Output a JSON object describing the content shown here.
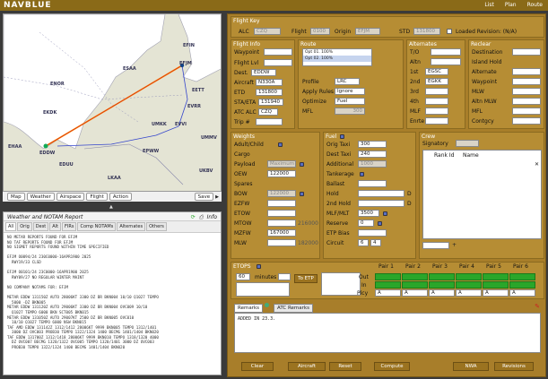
{
  "app": {
    "logo": "NAVBLUE",
    "links": [
      "List",
      "Plan",
      "Route"
    ]
  },
  "map": {
    "labels": [
      "EFIN",
      "ESAA",
      "ENOR",
      "EFJM",
      "EETT",
      "EKDK",
      "EVRR",
      "UMKK",
      "EVVI",
      "UMMV",
      "EHAA",
      "EDDW",
      "EDUU",
      "EPWW",
      "LKAA",
      "UKBV"
    ],
    "toolbar": [
      "Map",
      "Weather",
      "Airspace",
      "Flight",
      "Action",
      "Save"
    ]
  },
  "weather": {
    "title": "Weather and NOTAM Report",
    "info": "Info",
    "tabs": [
      "All",
      "Orig",
      "Dest",
      "Alt",
      "FIRs",
      "Comp NOTAMs",
      "Alternates",
      "Others"
    ],
    "lines": [
      "NO METAR REPORTS FOUND FOR EFJM",
      "NO TAF REPORTS FOUND FOR EFJM",
      "NO SIGMET REPORTS FOUND WITHIN TIME SPECIFIED",
      "",
      "EFJM O0094/24 230C0000-16APR1900 2025",
      "  RWY19/33 CLSD",
      "",
      "EFJM O0101/24 23C0000-16APR1900 2025",
      "  RWY09/27 NO REGULAR WINTER MAINT",
      "",
      "NO COMPANY NOTAMS FOR: EFJM",
      "",
      "METAR EDDW 131150Z AUTO 28006KT 3300 DZ BR BKN004 10/10 Q1027 TEMPO",
      "  5000 -DZ BKN005",
      "METAR EDDW 131120Z AUTO 29006KT 3300 DZ BR BKN004 OVC009 10/10",
      "  Q1027 TEMPO 6000 BKN SCT005 BKN015",
      "METAR EDDW 131050Z AUTO 29007KT 2500 DZ BR BKN005 OVC010",
      "  10/10 Q1027 TEMPO 6000 NSW BKN015",
      "TAF AMD EDDW 131142Z 1312/1412 28006KT 9999 BKN005 TEMPO 1312/1401",
      "  3000 DZ OVC003 PROB30 TEMPO 1322/1324 1400 BECMG 1401/1404 BKN020",
      "TAF EDDW 131700Z 1312/1418 28006KT 9999 BKN010 TEMPO 1318/1320 4000",
      "  DZ OVC007 BECMG 1320/1322 OVC005 TEMPO 1320/1401 3000 DZ OVC003",
      "  PROB30 TEMPO 1322/1324 1400 BECMG 1401/1404 BKN020"
    ]
  },
  "flight": {
    "section_key": "Flight Key",
    "alc_label": "ALC",
    "alc": "CZQ",
    "flight_label": "Flight",
    "flight": "0100",
    "origin_label": "Origin",
    "origin": "EFJM",
    "std_label": "STD",
    "std": "131800",
    "loaded_revision": "Loaded Revision: (N/A)",
    "info_title": "Flight Info",
    "waypoint_label": "Waypoint",
    "flightlvl_label": "Flight Lvl",
    "dest_label": "Dest.",
    "dest": "EDDW",
    "aircraft_label": "Aircraft",
    "aircraft": "N330A",
    "etd_label": "ETD",
    "etd": "131800",
    "staeta_label": "STA/ETA",
    "staeta": "131940",
    "atcalc_label": "ATC ALC",
    "atcalc": "CZQ",
    "trip_label": "Trip #",
    "route_title": "Route",
    "route_items": [
      "Opt 01. 100%",
      "Opt 02. 100%"
    ],
    "profile_label": "Profile",
    "profile": "LRC",
    "apply_label": "Apply Rules",
    "apply": "Ignore",
    "optimize_label": "Optimize",
    "optimize": "Fuel",
    "mfl_label": "MFL",
    "mfl": "300",
    "alt_title": "Alternates",
    "to_label": "T/O",
    "altn_label": "Altn",
    "alt1_label": "1st",
    "alt1": "EGSC",
    "alt2_label": "2nd",
    "alt2": "EGKK",
    "alt3_label": "3rd",
    "alt4_label": "4th",
    "mlf_label": "MLF",
    "enrte_label": "Enrte",
    "reclear_title": "Reclear",
    "destination_label": "Destination",
    "islandhold_label": "Island Hold",
    "alternate_label": "Alternate",
    "waypoint2_label": "Waypoint",
    "mlw_label": "MLW",
    "altnmlw_label": "Altn MLW",
    "mfl2_label": "MFL",
    "contgcy_label": "Contgcy",
    "weights_title": "Weights",
    "adult_label": "Adult/Child",
    "cargo_label": "Cargo",
    "payload_label": "Payload",
    "payload_hint": "Maximum",
    "oew_label": "OEW",
    "oew": "122000",
    "spares_label": "Spares",
    "bow_label": "BOW",
    "bow": "122000",
    "ezfw_label": "EZFW",
    "etow_label": "ETOW",
    "mtow_label": "MTOW",
    "mtow": "216000",
    "mzfw_label": "MZFW",
    "mzfw": "167000",
    "mlw2_label": "MLW",
    "mlw2": "182000",
    "fuel_title": "Fuel",
    "origtaxi_label": "Orig Taxi",
    "origtaxi": "300",
    "desttaxi_label": "Dest Taxi",
    "desttaxi": "240",
    "additional_label": "Additional",
    "additional": "1000",
    "tankerage_label": "Tankerage",
    "ballast_label": "Ballast",
    "hold_label": "Hold",
    "hold2_label": "2nd Hold",
    "mlfmlt_label": "MLF/MLT",
    "mlfmlt": "3500",
    "reserve_label": "Reserve",
    "reserve": "0",
    "etpbias_label": "ETP Bias",
    "circuit_label": "Circuit",
    "circuit1": "6",
    "circuit2": "4",
    "d_label": "D",
    "crew_title": "Crew",
    "signatory_label": "Signatory",
    "rankid_label": "Rank Id",
    "name_label": "Name",
    "etops_title": "ETOPS",
    "etops_value": "60",
    "minutes_label": "minutes",
    "toetp_label": "To ETP",
    "pairs": [
      "Pair 1",
      "Pair 2",
      "Pair 3",
      "Pair 4",
      "Pair 5",
      "Pair 6"
    ],
    "out_label": "Out",
    "in_label": "In",
    "plcy_label": "Plcy",
    "plcy_value": "A",
    "remarks_tabs": [
      "Remarks",
      "ATC Remarks"
    ],
    "remarks_text": "ADDED IN 23.3.",
    "actions": [
      "Clear",
      "Aircraft",
      "Reset",
      "Compute",
      "NWA",
      "Revisions"
    ]
  }
}
